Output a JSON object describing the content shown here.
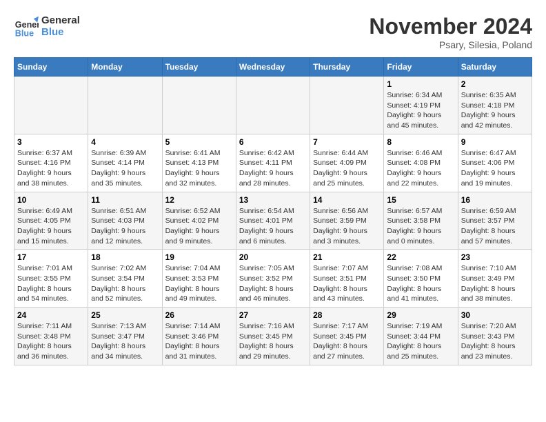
{
  "logo": {
    "line1": "General",
    "line2": "Blue"
  },
  "title": "November 2024",
  "location": "Psary, Silesia, Poland",
  "weekdays": [
    "Sunday",
    "Monday",
    "Tuesday",
    "Wednesday",
    "Thursday",
    "Friday",
    "Saturday"
  ],
  "weeks": [
    [
      {
        "day": "",
        "info": ""
      },
      {
        "day": "",
        "info": ""
      },
      {
        "day": "",
        "info": ""
      },
      {
        "day": "",
        "info": ""
      },
      {
        "day": "",
        "info": ""
      },
      {
        "day": "1",
        "info": "Sunrise: 6:34 AM\nSunset: 4:19 PM\nDaylight: 9 hours\nand 45 minutes."
      },
      {
        "day": "2",
        "info": "Sunrise: 6:35 AM\nSunset: 4:18 PM\nDaylight: 9 hours\nand 42 minutes."
      }
    ],
    [
      {
        "day": "3",
        "info": "Sunrise: 6:37 AM\nSunset: 4:16 PM\nDaylight: 9 hours\nand 38 minutes."
      },
      {
        "day": "4",
        "info": "Sunrise: 6:39 AM\nSunset: 4:14 PM\nDaylight: 9 hours\nand 35 minutes."
      },
      {
        "day": "5",
        "info": "Sunrise: 6:41 AM\nSunset: 4:13 PM\nDaylight: 9 hours\nand 32 minutes."
      },
      {
        "day": "6",
        "info": "Sunrise: 6:42 AM\nSunset: 4:11 PM\nDaylight: 9 hours\nand 28 minutes."
      },
      {
        "day": "7",
        "info": "Sunrise: 6:44 AM\nSunset: 4:09 PM\nDaylight: 9 hours\nand 25 minutes."
      },
      {
        "day": "8",
        "info": "Sunrise: 6:46 AM\nSunset: 4:08 PM\nDaylight: 9 hours\nand 22 minutes."
      },
      {
        "day": "9",
        "info": "Sunrise: 6:47 AM\nSunset: 4:06 PM\nDaylight: 9 hours\nand 19 minutes."
      }
    ],
    [
      {
        "day": "10",
        "info": "Sunrise: 6:49 AM\nSunset: 4:05 PM\nDaylight: 9 hours\nand 15 minutes."
      },
      {
        "day": "11",
        "info": "Sunrise: 6:51 AM\nSunset: 4:03 PM\nDaylight: 9 hours\nand 12 minutes."
      },
      {
        "day": "12",
        "info": "Sunrise: 6:52 AM\nSunset: 4:02 PM\nDaylight: 9 hours\nand 9 minutes."
      },
      {
        "day": "13",
        "info": "Sunrise: 6:54 AM\nSunset: 4:01 PM\nDaylight: 9 hours\nand 6 minutes."
      },
      {
        "day": "14",
        "info": "Sunrise: 6:56 AM\nSunset: 3:59 PM\nDaylight: 9 hours\nand 3 minutes."
      },
      {
        "day": "15",
        "info": "Sunrise: 6:57 AM\nSunset: 3:58 PM\nDaylight: 9 hours\nand 0 minutes."
      },
      {
        "day": "16",
        "info": "Sunrise: 6:59 AM\nSunset: 3:57 PM\nDaylight: 8 hours\nand 57 minutes."
      }
    ],
    [
      {
        "day": "17",
        "info": "Sunrise: 7:01 AM\nSunset: 3:55 PM\nDaylight: 8 hours\nand 54 minutes."
      },
      {
        "day": "18",
        "info": "Sunrise: 7:02 AM\nSunset: 3:54 PM\nDaylight: 8 hours\nand 52 minutes."
      },
      {
        "day": "19",
        "info": "Sunrise: 7:04 AM\nSunset: 3:53 PM\nDaylight: 8 hours\nand 49 minutes."
      },
      {
        "day": "20",
        "info": "Sunrise: 7:05 AM\nSunset: 3:52 PM\nDaylight: 8 hours\nand 46 minutes."
      },
      {
        "day": "21",
        "info": "Sunrise: 7:07 AM\nSunset: 3:51 PM\nDaylight: 8 hours\nand 43 minutes."
      },
      {
        "day": "22",
        "info": "Sunrise: 7:08 AM\nSunset: 3:50 PM\nDaylight: 8 hours\nand 41 minutes."
      },
      {
        "day": "23",
        "info": "Sunrise: 7:10 AM\nSunset: 3:49 PM\nDaylight: 8 hours\nand 38 minutes."
      }
    ],
    [
      {
        "day": "24",
        "info": "Sunrise: 7:11 AM\nSunset: 3:48 PM\nDaylight: 8 hours\nand 36 minutes."
      },
      {
        "day": "25",
        "info": "Sunrise: 7:13 AM\nSunset: 3:47 PM\nDaylight: 8 hours\nand 34 minutes."
      },
      {
        "day": "26",
        "info": "Sunrise: 7:14 AM\nSunset: 3:46 PM\nDaylight: 8 hours\nand 31 minutes."
      },
      {
        "day": "27",
        "info": "Sunrise: 7:16 AM\nSunset: 3:45 PM\nDaylight: 8 hours\nand 29 minutes."
      },
      {
        "day": "28",
        "info": "Sunrise: 7:17 AM\nSunset: 3:45 PM\nDaylight: 8 hours\nand 27 minutes."
      },
      {
        "day": "29",
        "info": "Sunrise: 7:19 AM\nSunset: 3:44 PM\nDaylight: 8 hours\nand 25 minutes."
      },
      {
        "day": "30",
        "info": "Sunrise: 7:20 AM\nSunset: 3:43 PM\nDaylight: 8 hours\nand 23 minutes."
      }
    ]
  ]
}
